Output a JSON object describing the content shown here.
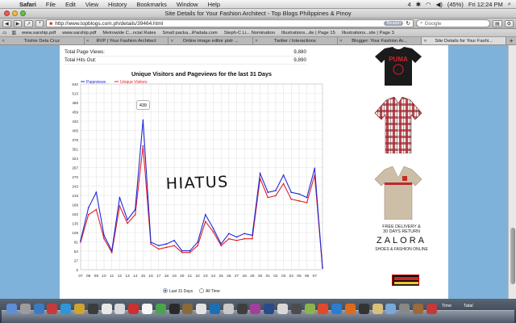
{
  "menubar": {
    "app": "Safari",
    "items": [
      "File",
      "Edit",
      "View",
      "History",
      "Bookmarks",
      "Window",
      "Help"
    ],
    "battery": "(45%)",
    "clock": "Fri 12:24 PM",
    "wifi_count": "4"
  },
  "window": {
    "title": "Site Details for Your Fashion Architect - Top Blogs Philippines & Pinoy"
  },
  "toolbar": {
    "url": "http://www.topblogs.com.ph/details/39464.html",
    "reader_label": "Reader",
    "search_placeholder": "Google"
  },
  "bookmarks": [
    "www.sarship.pdf",
    "www.sarship.pdf",
    "Metrowide C...ncial Rates",
    "Small packa...iPadala.com",
    "Steph-C Li... Nomination",
    "Illustrations...de | Page 15",
    "Illustrations...ide | Page 3"
  ],
  "tabs": [
    "Trishie Dela Cruz",
    "RVP | Your Fashion Architect",
    "Online image editor pixlr ...",
    "Twitter / Interactions",
    "Blogger: Your Fashion Ar...",
    "Site Details for Your Fashi..."
  ],
  "active_tab": 5,
  "stats": [
    {
      "label": "Total Page Views:",
      "value": "9,880"
    },
    {
      "label": "Total Hits Out:",
      "value": "9,890"
    }
  ],
  "chart_data": {
    "type": "line",
    "title": "Unique Visitors and Pageviews for the last 31 Days",
    "x": [
      "07",
      "08",
      "09",
      "10",
      "11",
      "12",
      "13",
      "14",
      "15",
      "16",
      "17",
      "18",
      "19",
      "20",
      "21",
      "22",
      "23",
      "24",
      "25",
      "26",
      "27",
      "28",
      "29",
      "30",
      "01",
      "02",
      "03",
      "04",
      "05",
      "06",
      "07"
    ],
    "ylim": [
      0,
      540
    ],
    "yticks": [
      0,
      27,
      54,
      81,
      108,
      135,
      162,
      189,
      216,
      243,
      270,
      297,
      324,
      351,
      378,
      405,
      432,
      459,
      486,
      513,
      540
    ],
    "series": [
      {
        "name": "Pageviews",
        "color": "#1f2ad8",
        "values": [
          85,
          180,
          225,
          100,
          55,
          210,
          145,
          175,
          435,
          80,
          70,
          75,
          85,
          55,
          55,
          80,
          160,
          120,
          75,
          105,
          95,
          105,
          100,
          280,
          225,
          230,
          275,
          225,
          220,
          210,
          295,
          5
        ]
      },
      {
        "name": "Unique Visitors",
        "color": "#e0202a",
        "values": [
          80,
          160,
          175,
          90,
          50,
          185,
          135,
          160,
          360,
          75,
          60,
          65,
          70,
          50,
          50,
          70,
          140,
          110,
          70,
          90,
          85,
          90,
          90,
          265,
          210,
          215,
          250,
          205,
          200,
          195,
          275,
          5
        ]
      }
    ],
    "tooltip": "439",
    "overlay_text": "HIATUS",
    "radio_options": [
      "Last 31 Days",
      "All Time"
    ],
    "selected_option": 0
  },
  "ads": {
    "brand": "PUMA",
    "free_delivery": "FREE DELIVERY &\n30 DAYS RETURN",
    "zalora": "ZALORA",
    "zalora_tagline": "SHOES & FASHION ONLINE"
  },
  "dock": {
    "labels": [
      "Time",
      "Tatal"
    ]
  }
}
